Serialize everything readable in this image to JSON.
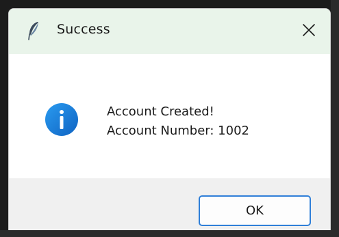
{
  "dialog": {
    "title": "Success",
    "message_line1": "Account Created!",
    "message_line2": "Account Number: 1002",
    "ok_label": "OK",
    "icons": {
      "app": "feather-icon",
      "info": "info-icon",
      "close": "close-icon"
    }
  },
  "colors": {
    "titlebar": "#e9f4ea",
    "info_blue": "#1a7fd4",
    "button_border": "#2f7fd8",
    "footer": "#f0f0f0"
  }
}
